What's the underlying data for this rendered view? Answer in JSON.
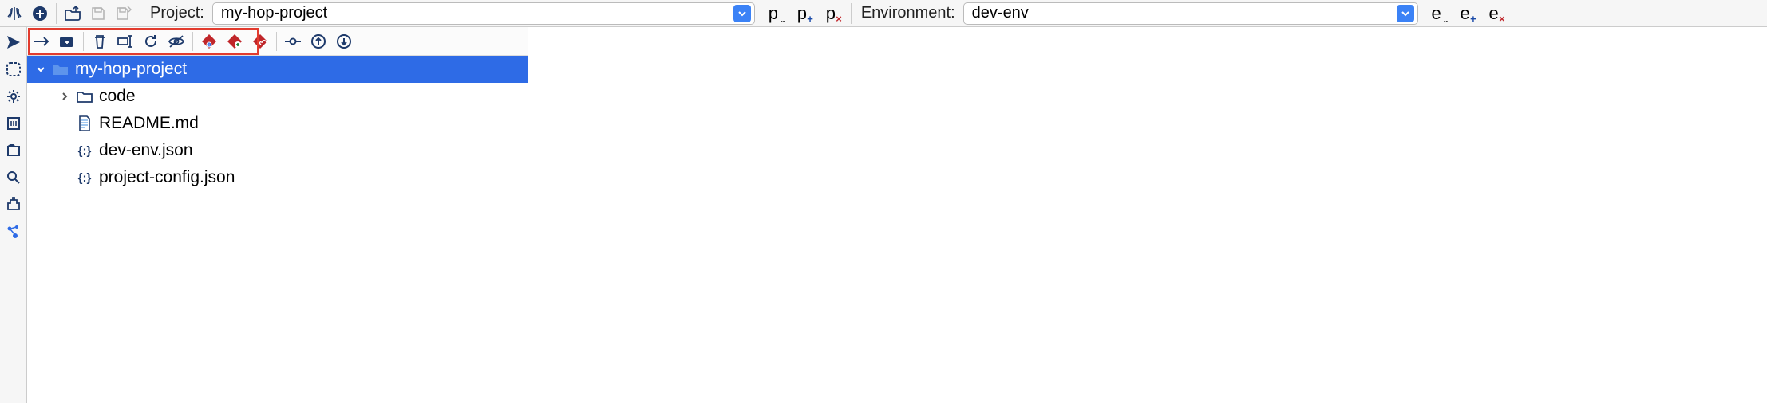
{
  "topbar": {
    "project_label": "Project:",
    "project_value": "my-hop-project",
    "env_label": "Environment:",
    "env_value": "dev-env"
  },
  "tree": {
    "root": "my-hop-project",
    "items": [
      {
        "label": "code",
        "type": "folder",
        "expandable": true
      },
      {
        "label": "README.md",
        "type": "file-doc"
      },
      {
        "label": "dev-env.json",
        "type": "file-json"
      },
      {
        "label": "project-config.json",
        "type": "file-json"
      }
    ]
  }
}
